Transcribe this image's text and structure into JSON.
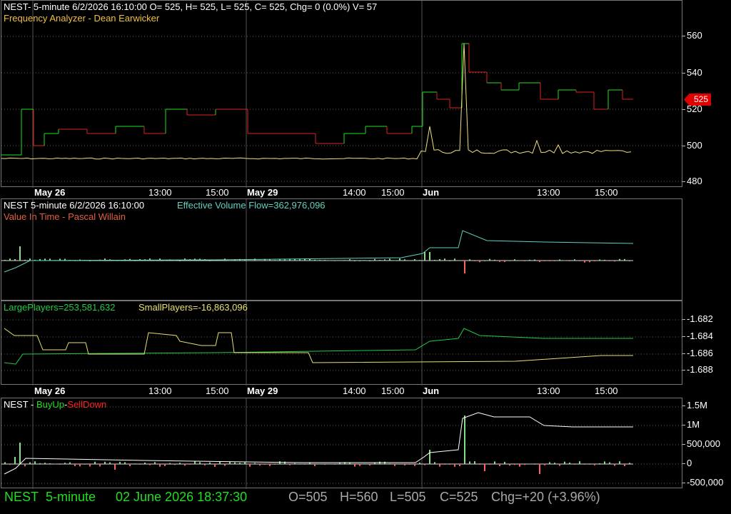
{
  "pane1": {
    "header": "NEST- 5-minute 6/2/2026 16:10:00 O= 525, H= 525, L= 525, C= 525, Chg= 0 (0.0%) V= 57",
    "indicator": "Frequency Analyzer - Dean Earwicker",
    "y_ticks": [
      "560",
      "540",
      "520",
      "500",
      "480"
    ],
    "last_price_badge": "525"
  },
  "xaxis_top": {
    "labels": [
      "May 26",
      "13:00",
      "15:00",
      "May 29",
      "14:00",
      "15:00",
      "Jun",
      "13:00",
      "15:00"
    ]
  },
  "pane2": {
    "header_symbol": "NEST 5-minute  6/2/2026 16:10:00",
    "header_flow": "Effective Volume Flow=362,976,096",
    "indicator": "Value In Time - Pascal Willain"
  },
  "pane3": {
    "large_players": "LargePlayers=253,581,632",
    "small_players": "SmallPlayers=-16,863,096",
    "y_ticks": [
      "-1.682",
      "-1.684",
      "-1.686",
      "-1.688"
    ]
  },
  "xaxis_bottom": {
    "labels": [
      "May 26",
      "13:00",
      "15:00",
      "May 29",
      "14:00",
      "15:00",
      "Jun",
      "13:00",
      "15:00"
    ]
  },
  "pane4": {
    "symbol": "NEST - ",
    "buy_label": "BuyUp",
    "dash": "-",
    "sell_label": "SellDown",
    "y_ticks": [
      "1.5M",
      "1M",
      "500,000",
      "0",
      "-500,000"
    ]
  },
  "status_bar": {
    "symbol": "NEST",
    "interval": "5-minute",
    "datetime": "02 June 2026 18:37:30",
    "open": "O=505",
    "high": "H=560",
    "low": "L=505",
    "close": "C=525",
    "change": "Chg=+20 (+3.96%)"
  },
  "colors": {
    "up": "#22dd22",
    "down": "#dd2222",
    "analyzer": "#f0e080",
    "flow": "#60d0c0",
    "large": "#22cc44",
    "small": "#e8e070",
    "grid": "#555555"
  }
}
